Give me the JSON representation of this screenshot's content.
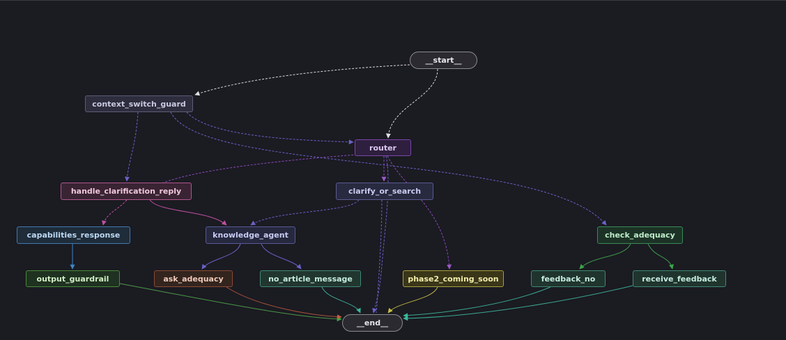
{
  "graph": {
    "nodes": {
      "start": "__start__",
      "context_switch_guard": "context_switch_guard",
      "router": "router",
      "handle_clarification_reply": "handle_clarification_reply",
      "clarify_or_search": "clarify_or_search",
      "capabilities_response": "capabilities_response",
      "knowledge_agent": "knowledge_agent",
      "check_adequacy": "check_adequacy",
      "output_guardrail": "output_guardrail",
      "ask_adequacy": "ask_adequacy",
      "no_article_message": "no_article_message",
      "phase2_coming_soon": "phase2_coming_soon",
      "feedback_no": "feedback_no",
      "receive_feedback": "receive_feedback",
      "end": "__end__"
    },
    "colors": {
      "background": "#1b1b22",
      "start_edge": "#d8d8dc",
      "guard_edge": "#6a62c8",
      "router_edge": "#8a4ab8",
      "clarification_edge": "#c050a0",
      "capabilities_edge": "#3e86c8",
      "adequacy_edge": "#3a9a4a",
      "output_edge": "#4a9a48",
      "ask_edge": "#a8523a",
      "teal_edge": "#3aa890",
      "phase2_edge": "#b8b040"
    }
  }
}
